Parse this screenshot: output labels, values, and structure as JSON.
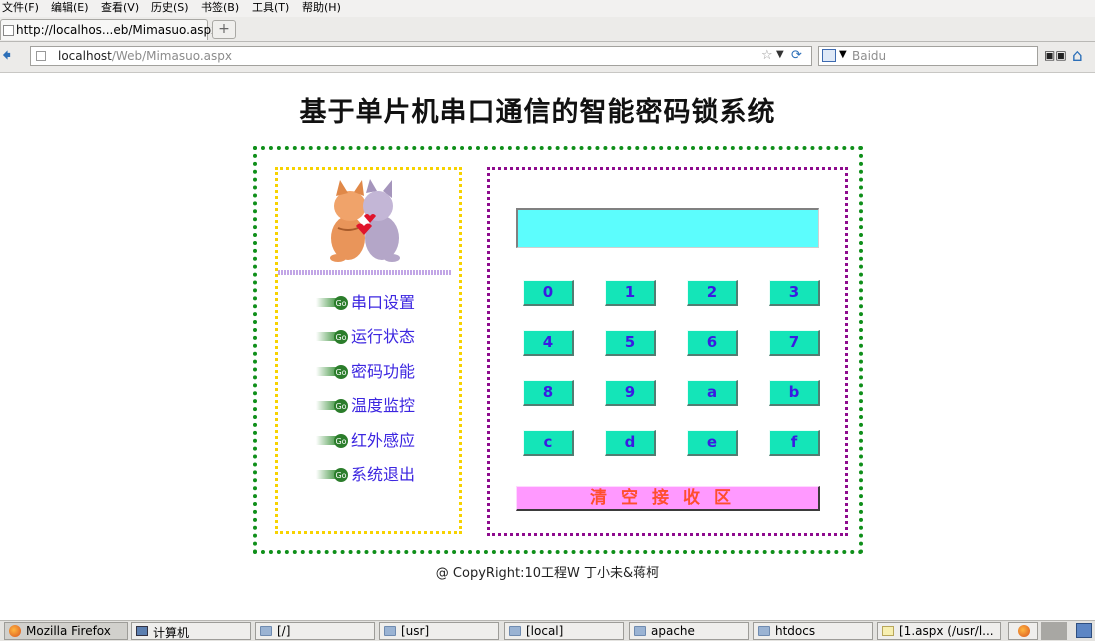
{
  "browser": {
    "menu": [
      "文件(F)",
      "编辑(E)",
      "查看(V)",
      "历史(S)",
      "书签(B)",
      "工具(T)",
      "帮助(H)"
    ],
    "tab_title": "http://localhos...eb/Mimasuo.aspx",
    "new_tab": "+",
    "url_host": "localhost",
    "url_path": "/Web/Mimasuo.aspx",
    "search_placeholder": "Baidu"
  },
  "page": {
    "title": "基于单片机串口通信的智能密码锁系统",
    "menu_items": [
      "串口设置",
      "运行状态",
      "密码功能",
      "温度监控",
      "红外感应",
      "系统退出"
    ],
    "display_value": "",
    "keys": [
      "0",
      "1",
      "2",
      "3",
      "4",
      "5",
      "6",
      "7",
      "8",
      "9",
      "a",
      "b",
      "c",
      "d",
      "e",
      "f"
    ],
    "clear_label": "清空接收区",
    "copyright": "@ CopyRight:10工程W 丁小未&蒋柯"
  },
  "taskbar": [
    {
      "label": "Mozilla Firefox",
      "icon": "firefox-icon"
    },
    {
      "label": "计算机",
      "icon": "computer-icon"
    },
    {
      "label": "[/]",
      "icon": "folder-icon"
    },
    {
      "label": "[usr]",
      "icon": "folder-icon"
    },
    {
      "label": "[local]",
      "icon": "folder-icon"
    },
    {
      "label": "apache",
      "icon": "folder-icon"
    },
    {
      "label": "htdocs",
      "icon": "folder-icon"
    },
    {
      "label": "[1.aspx (/usr/l...",
      "icon": "text-editor-icon"
    }
  ],
  "colors": {
    "outer_border": "#0f8f1a",
    "left_border": "#f7d200",
    "right_border": "#8e0b8e",
    "display_bg": "#5cfdfd",
    "key_bg": "#14e5b8",
    "key_text": "#3a1be2",
    "clear_bg": "#ff99ff",
    "clear_text": "#ff4e2e",
    "menu_text": "#3c26e0"
  }
}
